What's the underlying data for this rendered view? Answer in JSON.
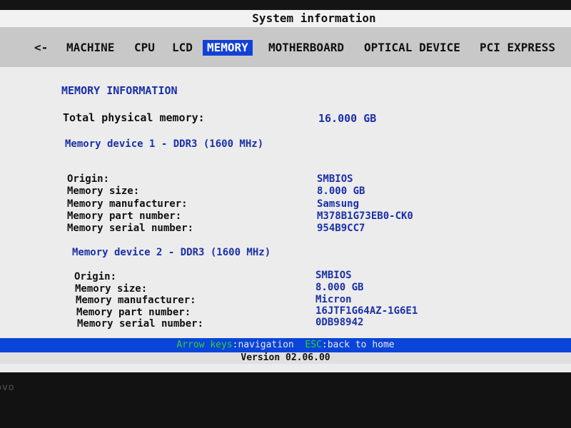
{
  "window": {
    "title": "System information"
  },
  "tabs": {
    "back": "<-",
    "items": [
      "MACHINE",
      "CPU",
      "LCD",
      "MEMORY",
      "MOTHERBOARD",
      "OPTICAL DEVICE",
      "PCI EXPRESS"
    ],
    "active": "MEMORY"
  },
  "memory": {
    "section_title": "MEMORY INFORMATION",
    "total_label": "Total physical memory:",
    "total_value": "16.000 GB",
    "devices": [
      {
        "title": "Memory device 1 - DDR3 (1600 MHz)",
        "fields": [
          {
            "label": "Origin:",
            "value": "SMBIOS"
          },
          {
            "label": "Memory size:",
            "value": "8.000 GB"
          },
          {
            "label": "Memory manufacturer:",
            "value": "Samsung"
          },
          {
            "label": "Memory part number:",
            "value": "M378B1G73EB0-CK0"
          },
          {
            "label": "Memory serial number:",
            "value": "954B9CC7"
          }
        ]
      },
      {
        "title": "Memory device 2 - DDR3 (1600 MHz)",
        "fields": [
          {
            "label": "Origin:",
            "value": "SMBIOS"
          },
          {
            "label": "Memory size:",
            "value": "8.000 GB"
          },
          {
            "label": "Memory manufacturer:",
            "value": "Micron"
          },
          {
            "label": "Memory part number:",
            "value": "16JTF1G64AZ-1G6E1"
          },
          {
            "label": "Memory serial number:",
            "value": "0DB98942"
          }
        ]
      }
    ]
  },
  "footer": {
    "arrow_key": "Arrow keys",
    "arrow_action": ":navigation",
    "esc_key": "ESC",
    "esc_action": ":back to home",
    "version": "Version 02.06.00"
  },
  "bezel": {
    "brand": "ovo"
  },
  "colors": {
    "accent": "#1240d8",
    "value_text": "#1a30a8",
    "status_bar": "#0a44d8",
    "key_hint": "#2fd13a"
  }
}
